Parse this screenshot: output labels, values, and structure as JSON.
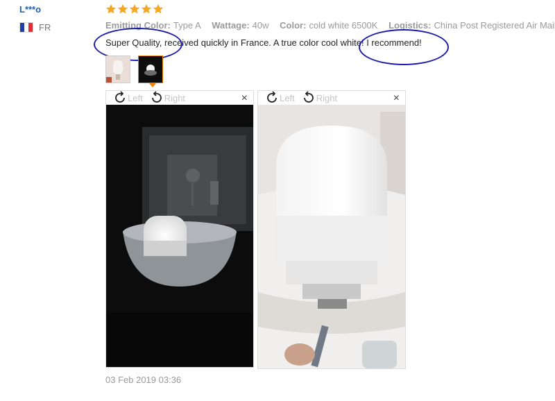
{
  "reviewer": {
    "name": "L***o",
    "country": "FR",
    "flag_colors": [
      "#1f3ea8",
      "#ffffff",
      "#e0303a"
    ]
  },
  "rating": {
    "stars": 5,
    "max": 5,
    "color": "#f5a623"
  },
  "attributes": [
    {
      "label": "Emitting Color:",
      "value": "Type A"
    },
    {
      "label": "Wattage:",
      "value": "40w"
    },
    {
      "label": "Color:",
      "value": "cold white 6500K"
    },
    {
      "label": "Logistics:",
      "value": "China Post Registered Air Mail"
    }
  ],
  "review_text": "Super Quality, received quickly in France. A true color cool white! I recommend!",
  "annotation_color": "#1d1da8",
  "thumbnails": [
    {
      "icon": "lamp-photo-thumbnail",
      "active": false
    },
    {
      "icon": "dark-lamp-photo-thumbnail",
      "active": true
    }
  ],
  "viewer": {
    "rotate_left_label": "Left",
    "rotate_right_label": "Right",
    "close_label": "×"
  },
  "date": "03 Feb 2019 03:36",
  "accent_color": "#f08200"
}
